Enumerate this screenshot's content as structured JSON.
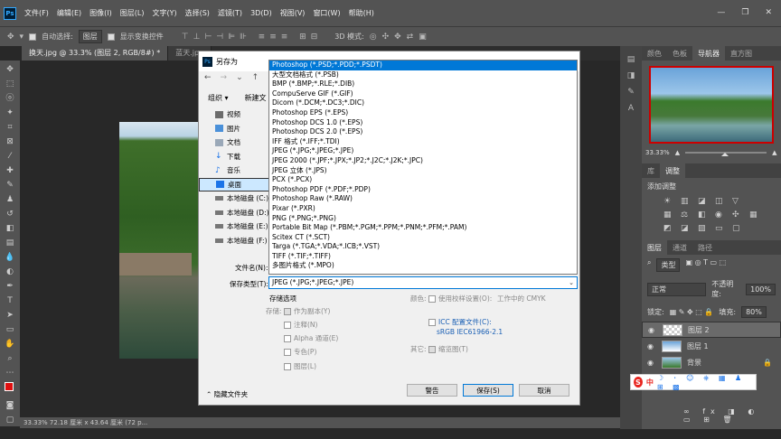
{
  "app": {
    "logo_text": "Ps",
    "menus": [
      "文件(F)",
      "编辑(E)",
      "图像(I)",
      "图层(L)",
      "文字(Y)",
      "选择(S)",
      "滤镜(T)",
      "3D(D)",
      "视图(V)",
      "窗口(W)",
      "帮助(H)"
    ],
    "win_min": "—",
    "win_max": "❐",
    "win_close": "✕"
  },
  "options_bar": {
    "auto_select_label": "自动选择:",
    "auto_select_value": "图层",
    "show_transform_label": "显示变换控件",
    "mode_3d_label": "3D 模式:"
  },
  "doc_tabs": [
    {
      "label": "换天.jpg @ 33.3% (图层 2, RGB/8#) *",
      "active": true
    },
    {
      "label": "蓝天.jpg",
      "active": false
    }
  ],
  "status_bar": {
    "text": "33.33%   72.18 厘米 x 43.64 厘米 (72 p..."
  },
  "right_panels": {
    "top_tabs": [
      "颜色",
      "色板",
      "导航器",
      "直方图"
    ],
    "top_active": 2,
    "zoom": "33.33%",
    "adjust_tabs": [
      "库",
      "调整"
    ],
    "adjust_active": 1,
    "adjust_title": "添加调整",
    "layer_tabs": [
      "图层",
      "通道",
      "路径"
    ],
    "layer_active": 0,
    "kind_label": "类型",
    "blend_mode": "正常",
    "opacity_label": "不透明度:",
    "opacity_value": "100%",
    "lock_label": "锁定:",
    "fill_label": "填充:",
    "fill_value": "80%",
    "layers": [
      {
        "name": "图层 2",
        "selected": true
      },
      {
        "name": "图层 1",
        "selected": false
      },
      {
        "name": "背景",
        "selected": false
      }
    ]
  },
  "dialog": {
    "title": "另存为",
    "organize": "组织 ▾",
    "new_folder": "新建文",
    "sidebar": [
      {
        "label": "视频",
        "icon": "video-icon"
      },
      {
        "label": "图片",
        "icon": "pictures-icon"
      },
      {
        "label": "文档",
        "icon": "documents-icon"
      },
      {
        "label": "下载",
        "icon": "download-icon"
      },
      {
        "label": "音乐",
        "icon": "music-icon"
      },
      {
        "label": "桌面",
        "icon": "desktop-icon",
        "selected": true
      },
      {
        "label": "本地磁盘 (C:)",
        "icon": "drive-icon"
      },
      {
        "label": "本地磁盘 (D:)",
        "icon": "drive-icon"
      },
      {
        "label": "本地磁盘 (E:)",
        "icon": "drive-icon"
      },
      {
        "label": "本地磁盘 (F:)",
        "icon": "drive-icon"
      }
    ],
    "filename_label": "文件名(N):",
    "filetype_label": "保存类型(T):",
    "filetype_value": "JPEG (*.JPG;*.JPEG;*.JPE)",
    "type_options": [
      "Photoshop (*.PSD;*.PDD;*.PSDT)",
      "大型文档格式 (*.PSB)",
      "BMP (*.BMP;*.RLE;*.DIB)",
      "CompuServe GIF (*.GIF)",
      "Dicom (*.DCM;*.DC3;*.DIC)",
      "Photoshop EPS (*.EPS)",
      "Photoshop DCS 1.0 (*.EPS)",
      "Photoshop DCS 2.0 (*.EPS)",
      "IFF 格式 (*.IFF;*.TDI)",
      "JPEG (*.JPG;*.JPEG;*.JPE)",
      "JPEG 2000 (*.JPF;*.JPX;*.JP2;*.J2C;*.J2K;*.JPC)",
      "JPEG 立体 (*.JPS)",
      "PCX (*.PCX)",
      "Photoshop PDF (*.PDF;*.PDP)",
      "Photoshop Raw (*.RAW)",
      "Pixar (*.PXR)",
      "PNG (*.PNG;*.PNG)",
      "Portable Bit Map (*.PBM;*.PGM;*.PPM;*.PNM;*.PFM;*.PAM)",
      "Scitex CT (*.SCT)",
      "Targa (*.TGA;*.VDA;*.ICB;*.VST)",
      "TIFF (*.TIF;*.TIFF)",
      "多图片格式 (*.MPO)"
    ],
    "highlighted_index": 0,
    "save_options_title": "存储选项",
    "save_label": "存储:",
    "as_copy": "作为副本(Y)",
    "notes": "注释(N)",
    "alpha": "Alpha 通道(E)",
    "spot": "专色(P)",
    "layers": "图层(L)",
    "color_label": "颜色:",
    "proof_setup": "使用校样设置(O):",
    "proof_setup_2": "工作中的 CMYK",
    "icc_profile": "ICC 配置文件(C):",
    "icc_value": "sRGB IEC61966-2.1",
    "other_label": "其它:",
    "thumbnail": "缩览图(T)",
    "hide_folders": "隐藏文件夹",
    "warning_btn": "警告",
    "save_btn": "保存(S)",
    "cancel_btn": "取消"
  },
  "ime": {
    "logo": "S",
    "lang": "中"
  }
}
